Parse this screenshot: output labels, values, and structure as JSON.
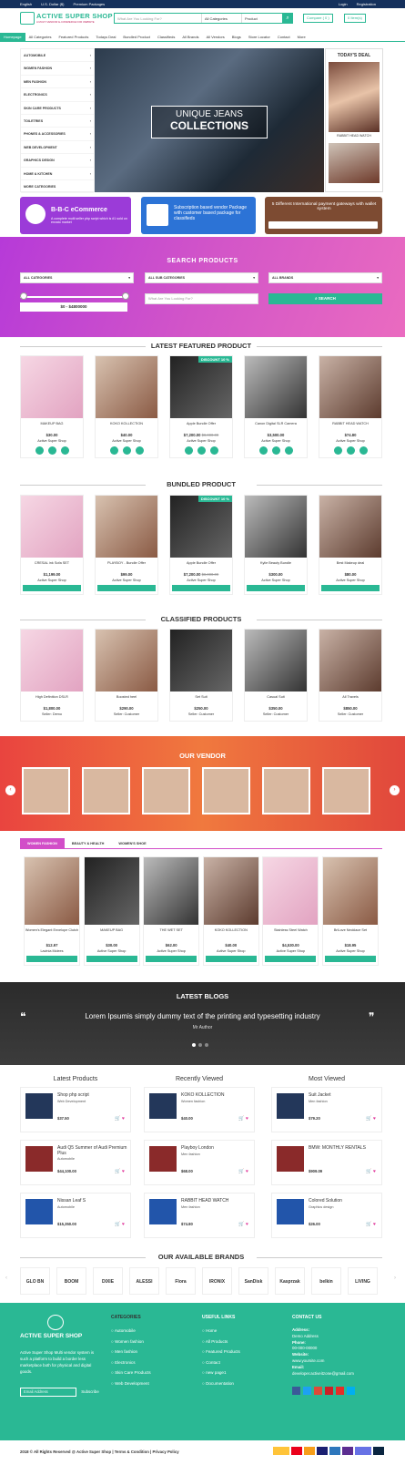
{
  "topbar": {
    "lang": "English",
    "currency": "U.S. Dollar ($)",
    "premium": "Premium Packages",
    "login": "Login",
    "register": "Registration"
  },
  "header": {
    "logo": "ACTIVE SUPER SHOP",
    "tagline": "A MULTI VENDOR E-COMMERCE FOR WEBSITE",
    "search_placeholder": "What Are You Looking For?",
    "search_cat": "All Categories",
    "search_type": "Product",
    "compare": "Compare ( 0 )",
    "cart": "0 Item(s)"
  },
  "nav": [
    "Homepage",
    "All Categories",
    "Featured Products",
    "Todays Deal",
    "Bundled Product",
    "Classifieds",
    "All Brands",
    "All Vendors",
    "Blogs",
    "Store Locator",
    "Contact",
    "More"
  ],
  "categories": [
    "AUTOMOBILE",
    "WOMEN FASHION",
    "MEN FASHION",
    "ELECTRONICS",
    "SKIN CARE PRODUCTS",
    "TOILETRIES",
    "PHONES & ACCESSORIES",
    "WEB DEVELOPMENT",
    "GRAPHICS DESIGN",
    "HOME & KITCHEN",
    "MORE CATEGORIES"
  ],
  "hero": {
    "line1": "UNIQUE JEANS",
    "line2": "COLLECTIONS"
  },
  "deal": {
    "title": "TODAY'S DEAL",
    "item": "RABBIT HEAD WATCH"
  },
  "banners": [
    {
      "title": "B-B-C eCommerce",
      "sub": "A complete multi seller php script which is #1 sold on envato market"
    },
    {
      "title": "Subscription based vendor Package with customer based package for classifieds"
    },
    {
      "title": "5 Different International payment gateways with wallet system"
    }
  ],
  "search": {
    "title": "SEARCH PRODUCTS",
    "cat": "ALL CATEGORIES",
    "subcat": "ALL SUB CATEGORIES",
    "brand": "ALL BRANDS",
    "range": "$0 - $4800000",
    "placeholder": "What Are You Looking For?",
    "button": "SEARCH"
  },
  "featured": {
    "title": "LATEST FEATURED PRODUCT",
    "items": [
      {
        "name": "MAKEUP BAG",
        "price": "$30.00",
        "old": "",
        "seller": "Active Super Shop",
        "badge": ""
      },
      {
        "name": "KOKO KOLLECTION",
        "price": "$40.00",
        "old": "",
        "seller": "Active Super Shop",
        "badge": ""
      },
      {
        "name": "Apple Bundle Offer",
        "price": "$7,200.00",
        "old": "$8,000.00",
        "seller": "Active Super Shop",
        "badge": "DISCOUNT 10 %"
      },
      {
        "name": "Canon Digital SLR Camera",
        "price": "$3,500.00",
        "old": "",
        "seller": "Active Super Shop",
        "badge": ""
      },
      {
        "name": "RABBIT HEAD WATCH",
        "price": "$74.80",
        "old": "",
        "seller": "Active Super Shop",
        "badge": ""
      }
    ]
  },
  "bundled": {
    "title": "BUNDLED PRODUCT",
    "items": [
      {
        "name": "CRESAL ink Sofa SET",
        "price": "$1,199.00",
        "old": "",
        "seller": "Active Super Shop",
        "badge": ""
      },
      {
        "name": "PLAYBOY - Bundle Offer",
        "price": "$99.00",
        "old": "",
        "seller": "Active Super Shop",
        "badge": ""
      },
      {
        "name": "Apple Bundle Offer",
        "price": "$7,200.00",
        "old": "$8,000.00",
        "seller": "Active Super Shop",
        "badge": "DISCOUNT 10 %"
      },
      {
        "name": "Kylie Beauty Bundle",
        "price": "$300.00",
        "old": "",
        "seller": "Active Super Shop",
        "badge": ""
      },
      {
        "name": "Best Makeup deal",
        "price": "$80.00",
        "old": "",
        "seller": "Active Super Shop",
        "badge": ""
      }
    ]
  },
  "classified": {
    "title": "CLASSIFIED PRODUCTS",
    "items": [
      {
        "name": "High Definition DSLR",
        "price": "$1,800.00",
        "seller": "Seller: Demo"
      },
      {
        "name": "Boosted heel",
        "price": "$290.00",
        "seller": "Seller: Customer"
      },
      {
        "name": "Set Suit",
        "price": "$250.00",
        "seller": "Seller: Customer"
      },
      {
        "name": "Casual Suit",
        "price": "$350.00",
        "seller": "Seller: Customer"
      },
      {
        "name": "All Travels",
        "price": "$850.00",
        "seller": "Seller: Customer"
      }
    ]
  },
  "vendor": {
    "title": "OUR VENDOR"
  },
  "tabs": [
    "WOMEN FASHION",
    "BEAUTY & HEALTH",
    "WOMEN'S SHOE"
  ],
  "tabitems": [
    {
      "name": "Women's Elegant Envelope Clutch",
      "price": "$12.97",
      "seller": "Lavinia Mclees"
    },
    {
      "name": "MAKEUP BAG",
      "price": "$30.00",
      "seller": "Active Super Shop"
    },
    {
      "name": "THE WET SET",
      "price": "$62.00",
      "seller": "Active Super Shop"
    },
    {
      "name": "KOKO KOLLECTION",
      "price": "$40.00",
      "seller": "Active Super Shop"
    },
    {
      "name": "Stainless Steel Watch",
      "price": "$4,530.00",
      "seller": "Active Super Shop"
    },
    {
      "name": "BriLove Necklace Set",
      "price": "$18.95",
      "seller": "Active Super Shop"
    }
  ],
  "blogs": {
    "title": "LATEST BLOGS",
    "text": "Lorem Ipsumis simply dummy text of the printing and typesetting industry",
    "author": "Mr Author"
  },
  "lists": {
    "latest": {
      "title": "Latest Products",
      "items": [
        {
          "name": "Shop php script",
          "cat": "Web Development",
          "price": "$37.50"
        },
        {
          "name": "Audi Q5 Summer of Audi Premium Plus",
          "cat": "Automobile",
          "price": "$44,100.00"
        },
        {
          "name": "Nissan Leaf S",
          "cat": "Automobile",
          "price": "$15,350.00"
        }
      ]
    },
    "recent": {
      "title": "Recently Viewed",
      "items": [
        {
          "name": "KOKO KOLLECTION",
          "cat": "Women fashion",
          "price": "$40.00"
        },
        {
          "name": "Playboy London",
          "cat": "Men fashion",
          "price": "$68.00"
        },
        {
          "name": "RABBIT HEAD WATCH",
          "cat": "Men fashion",
          "price": "$74.80"
        }
      ]
    },
    "most": {
      "title": "Most Viewed",
      "items": [
        {
          "name": "Suit Jacket",
          "cat": "Men fashion",
          "price": "$79.20"
        },
        {
          "name": "BMW: MONTHLY RENTALS",
          "cat": "",
          "price": "$909.09"
        },
        {
          "name": "Colored Solution",
          "cat": "Graphics design",
          "price": "$26.00"
        }
      ]
    }
  },
  "brands": {
    "title": "OUR AVAILABLE BRANDS",
    "items": [
      "GLO BN",
      "BOOM",
      "DIXIE",
      "ALESSI",
      "Flora",
      "IRONIX",
      "SanDisk",
      "Kasprzak",
      "belkin",
      "LIVING"
    ]
  },
  "footer": {
    "logo": "ACTIVE SUPER SHOP",
    "about": "Active Super Shop Multi vendor system is such a platform to build a border less marketplace both for physical and digital goods.",
    "email_ph": "Email Address",
    "subscribe": "Subscribe",
    "cat_title": "CATEGORIES",
    "cats": [
      "Automobile",
      "Women fashion",
      "Men fashion",
      "Electronics",
      "Skin Care Products",
      "Web Development"
    ],
    "links_title": "USEFUL LINKS",
    "links": [
      "Home",
      "All Products",
      "Featured Products",
      "Contact",
      "new page1",
      "Documentation"
    ],
    "contact_title": "CONTACT US",
    "address_l": "Address:",
    "address": "Demo Address",
    "phone_l": "Phone:",
    "phone": "00-000-00000",
    "web_l": "Website:",
    "web": "www.yoursite.com",
    "email_l": "Email:",
    "email": "developer.activeitzone@gmail.com"
  },
  "bottom": {
    "copy": "2018 © All Rights Reserved @ Active Super Shop | Terms & Condition | Privacy Policy"
  }
}
